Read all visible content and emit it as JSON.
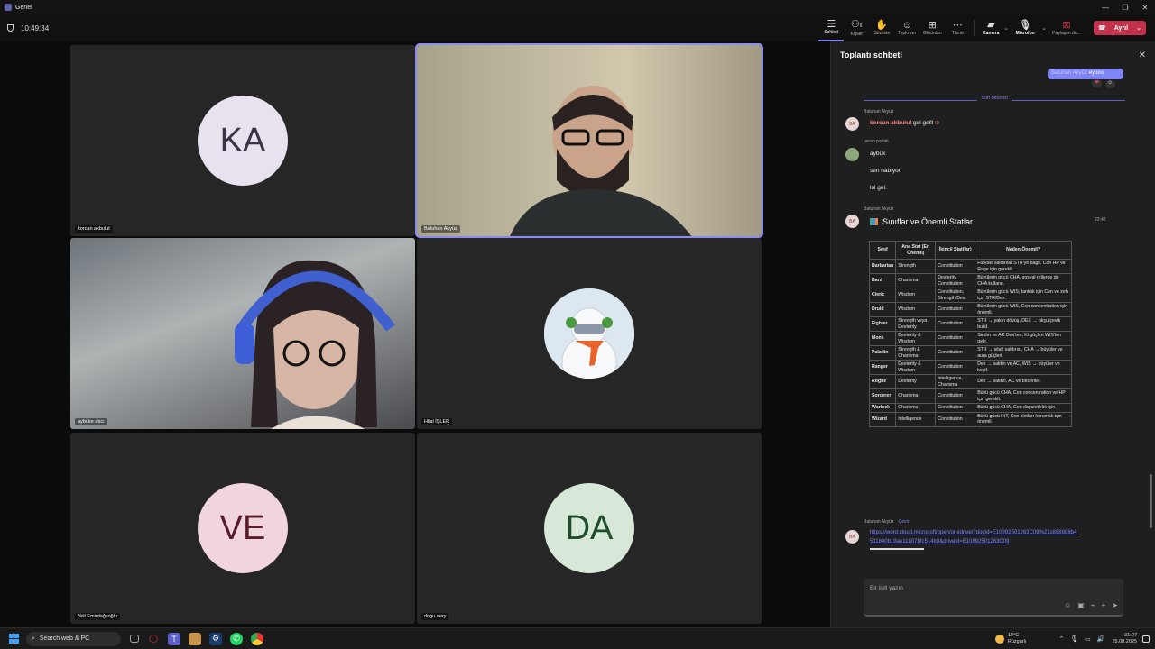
{
  "window": {
    "title": "Genel"
  },
  "toolbar": {
    "timer": "10:49:34",
    "tools": [
      {
        "label": "Sohbet",
        "icon": "chat-icon"
      },
      {
        "label": "Kişiler",
        "icon": "people-icon",
        "badge": "6"
      },
      {
        "label": "Söz iste",
        "icon": "raise-hand-icon"
      },
      {
        "label": "Tepki ver",
        "icon": "react-icon"
      },
      {
        "label": "Görünüm",
        "icon": "view-icon"
      },
      {
        "label": "Tümü",
        "icon": "more-icon"
      }
    ],
    "camera_label": "Kamera",
    "mic_label": "Mikrofon",
    "share_label": "Paylaşım du...",
    "leave_label": "Ayrıl"
  },
  "participants": [
    {
      "name": "korcan akbulut",
      "initials": "KA"
    },
    {
      "name": "Batuhan Akyüz"
    },
    {
      "name": "aybüke atıcı"
    },
    {
      "name": "Hilal İŞLER"
    },
    {
      "name": "Veli Emirdağlıoğlu",
      "initials": "VE"
    },
    {
      "name": "dogu aery",
      "initials": "DA"
    }
  ],
  "chat": {
    "title": "Toplantı sohbeti",
    "last_message_sender": "Batuhan Akyüz",
    "last_message_text": "eyooo",
    "reactions": [
      "❤",
      "☺"
    ],
    "divider": "Son okunan",
    "messages": [
      {
        "sender": "Batuhan Akyüz",
        "initials": "BA",
        "mention": "korcan akbulut",
        "text": "gel gelll"
      },
      {
        "sender": "baran parlak",
        "lines": [
          "aybük",
          "sen nabıyon",
          "lol gel."
        ]
      },
      {
        "sender": "Batuhan Akyüz",
        "initials": "BA",
        "card_title": "Sınıflar ve Önemli Statlar",
        "time": "23:42"
      },
      {
        "sender": "Batuhan Akyüz",
        "initials": "BA",
        "translate": "Çevir",
        "link": "https://word.cloud.microsoft/open/onedrive/?docId=E10892501263C09%21s898988b4511840b19ae11807bfc514b0&driveId=E10892501263C09"
      }
    ],
    "table": {
      "headers": [
        "Sınıf",
        "Ana Stat (En Önemli)",
        "İkincil Stat(lar)",
        "Neden Önemli?"
      ],
      "rows": [
        [
          "Barbarian",
          "Strength",
          "Constitution",
          "Fiziksel saldırılar STR'ye bağlı. Con HP ve Rage için gerekli."
        ],
        [
          "Bard",
          "Charisma",
          "Dexterity, Constitution",
          "Büyülerin gücü CHA, sosyal rollerde de CHA kullanır."
        ],
        [
          "Cleric",
          "Wisdom",
          "Constitution, Strength/Dex",
          "Büyülerin gücü WIS; tanklık için Con ve zırh için STR/Dex."
        ],
        [
          "Druid",
          "Wisdom",
          "Constitution",
          "Büyülerin gücü WIS, Con concentration için önemli."
        ],
        [
          "Fighter",
          "Strength veya Dexterity",
          "Constitution",
          "STR → yakın dövüş, DEX → okçu/çevik build."
        ],
        [
          "Monk",
          "Dexterity & Wisdom",
          "Constitution",
          "Saldırı ve AC Dex'ten, Ki güçleri WIS'ten gelir."
        ],
        [
          "Paladin",
          "Strength & Charisma",
          "Constitution",
          "STR → silah saldırısı, CHA → büyüler ve aura güçleri."
        ],
        [
          "Ranger",
          "Dexterity & Wisdom",
          "Constitution",
          "Dex → saldırı ve AC, WIS → büyüler ve keşif."
        ],
        [
          "Rogue",
          "Dexterity",
          "Intelligence, Charisma",
          "Dex → saldırı, AC ve beceriler."
        ],
        [
          "Sorcerer",
          "Charisma",
          "Constitution",
          "Büyü gücü CHA, Con concentration ve HP için gerekli."
        ],
        [
          "Warlock",
          "Charisma",
          "Constitution",
          "Büyü gücü CHA, Con dayanıklılık için."
        ],
        [
          "Wizard",
          "Intelligence",
          "Constitution",
          "Büyü gücü INT, Con slotları korumak için önemli."
        ]
      ]
    },
    "compose_placeholder": "Bir ileti yazın"
  },
  "taskbar": {
    "search_placeholder": "Search web & PC",
    "weather_temp": "19°C",
    "weather_desc": "Rüzgarlı",
    "time": "01:07",
    "date": "25.08.2025"
  },
  "colors": {
    "accent": "#7f85f5",
    "leave": "#c4314b",
    "panel": "#1f1f1f"
  }
}
